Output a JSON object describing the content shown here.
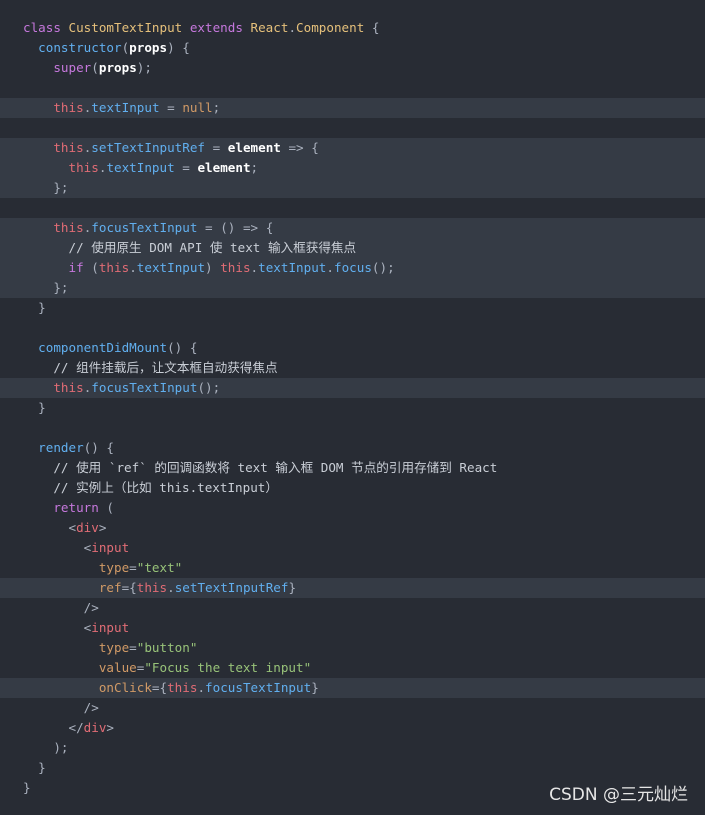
{
  "colors": {
    "background": "#282c34",
    "highlight_row": "#353b45",
    "keyword": "#c678dd",
    "class_name": "#e5c07b",
    "function": "#61afef",
    "string": "#98c379",
    "tag": "#e06c75"
  },
  "code": {
    "lines": [
      {
        "text": "class CustomTextInput extends React.Component {",
        "highlighted": false
      },
      {
        "text": "  constructor(props) {",
        "highlighted": false
      },
      {
        "text": "    super(props);",
        "highlighted": false
      },
      {
        "text": "",
        "highlighted": false
      },
      {
        "text": "    this.textInput = null;",
        "highlighted": true
      },
      {
        "text": "",
        "highlighted": false
      },
      {
        "text": "    this.setTextInputRef = element => {",
        "highlighted": true
      },
      {
        "text": "      this.textInput = element;",
        "highlighted": true
      },
      {
        "text": "    };",
        "highlighted": true
      },
      {
        "text": "",
        "highlighted": false
      },
      {
        "text": "    this.focusTextInput = () => {",
        "highlighted": true
      },
      {
        "text": "      // 使用原生 DOM API 使 text 输入框获得焦点",
        "highlighted": true
      },
      {
        "text": "      if (this.textInput) this.textInput.focus();",
        "highlighted": true
      },
      {
        "text": "    };",
        "highlighted": true
      },
      {
        "text": "  }",
        "highlighted": false
      },
      {
        "text": "",
        "highlighted": false
      },
      {
        "text": "  componentDidMount() {",
        "highlighted": false
      },
      {
        "text": "    // 组件挂载后，让文本框自动获得焦点",
        "highlighted": false
      },
      {
        "text": "    this.focusTextInput();",
        "highlighted": true
      },
      {
        "text": "  }",
        "highlighted": false
      },
      {
        "text": "",
        "highlighted": false
      },
      {
        "text": "  render() {",
        "highlighted": false
      },
      {
        "text": "    // 使用 `ref` 的回调函数将 text 输入框 DOM 节点的引用存储到 React",
        "highlighted": false
      },
      {
        "text": "    // 实例上（比如 this.textInput）",
        "highlighted": false
      },
      {
        "text": "    return (",
        "highlighted": false
      },
      {
        "text": "      <div>",
        "highlighted": false
      },
      {
        "text": "        <input",
        "highlighted": false
      },
      {
        "text": "          type=\"text\"",
        "highlighted": false
      },
      {
        "text": "          ref={this.setTextInputRef}",
        "highlighted": true
      },
      {
        "text": "        />",
        "highlighted": false
      },
      {
        "text": "        <input",
        "highlighted": false
      },
      {
        "text": "          type=\"button\"",
        "highlighted": false
      },
      {
        "text": "          value=\"Focus the text input\"",
        "highlighted": false
      },
      {
        "text": "          onClick={this.focusTextInput}",
        "highlighted": true
      },
      {
        "text": "        />",
        "highlighted": false
      },
      {
        "text": "      </div>",
        "highlighted": false
      },
      {
        "text": "    );",
        "highlighted": false
      },
      {
        "text": "  }",
        "highlighted": false
      },
      {
        "text": "}",
        "highlighted": false
      }
    ]
  },
  "watermark": "CSDN @三元灿烂"
}
